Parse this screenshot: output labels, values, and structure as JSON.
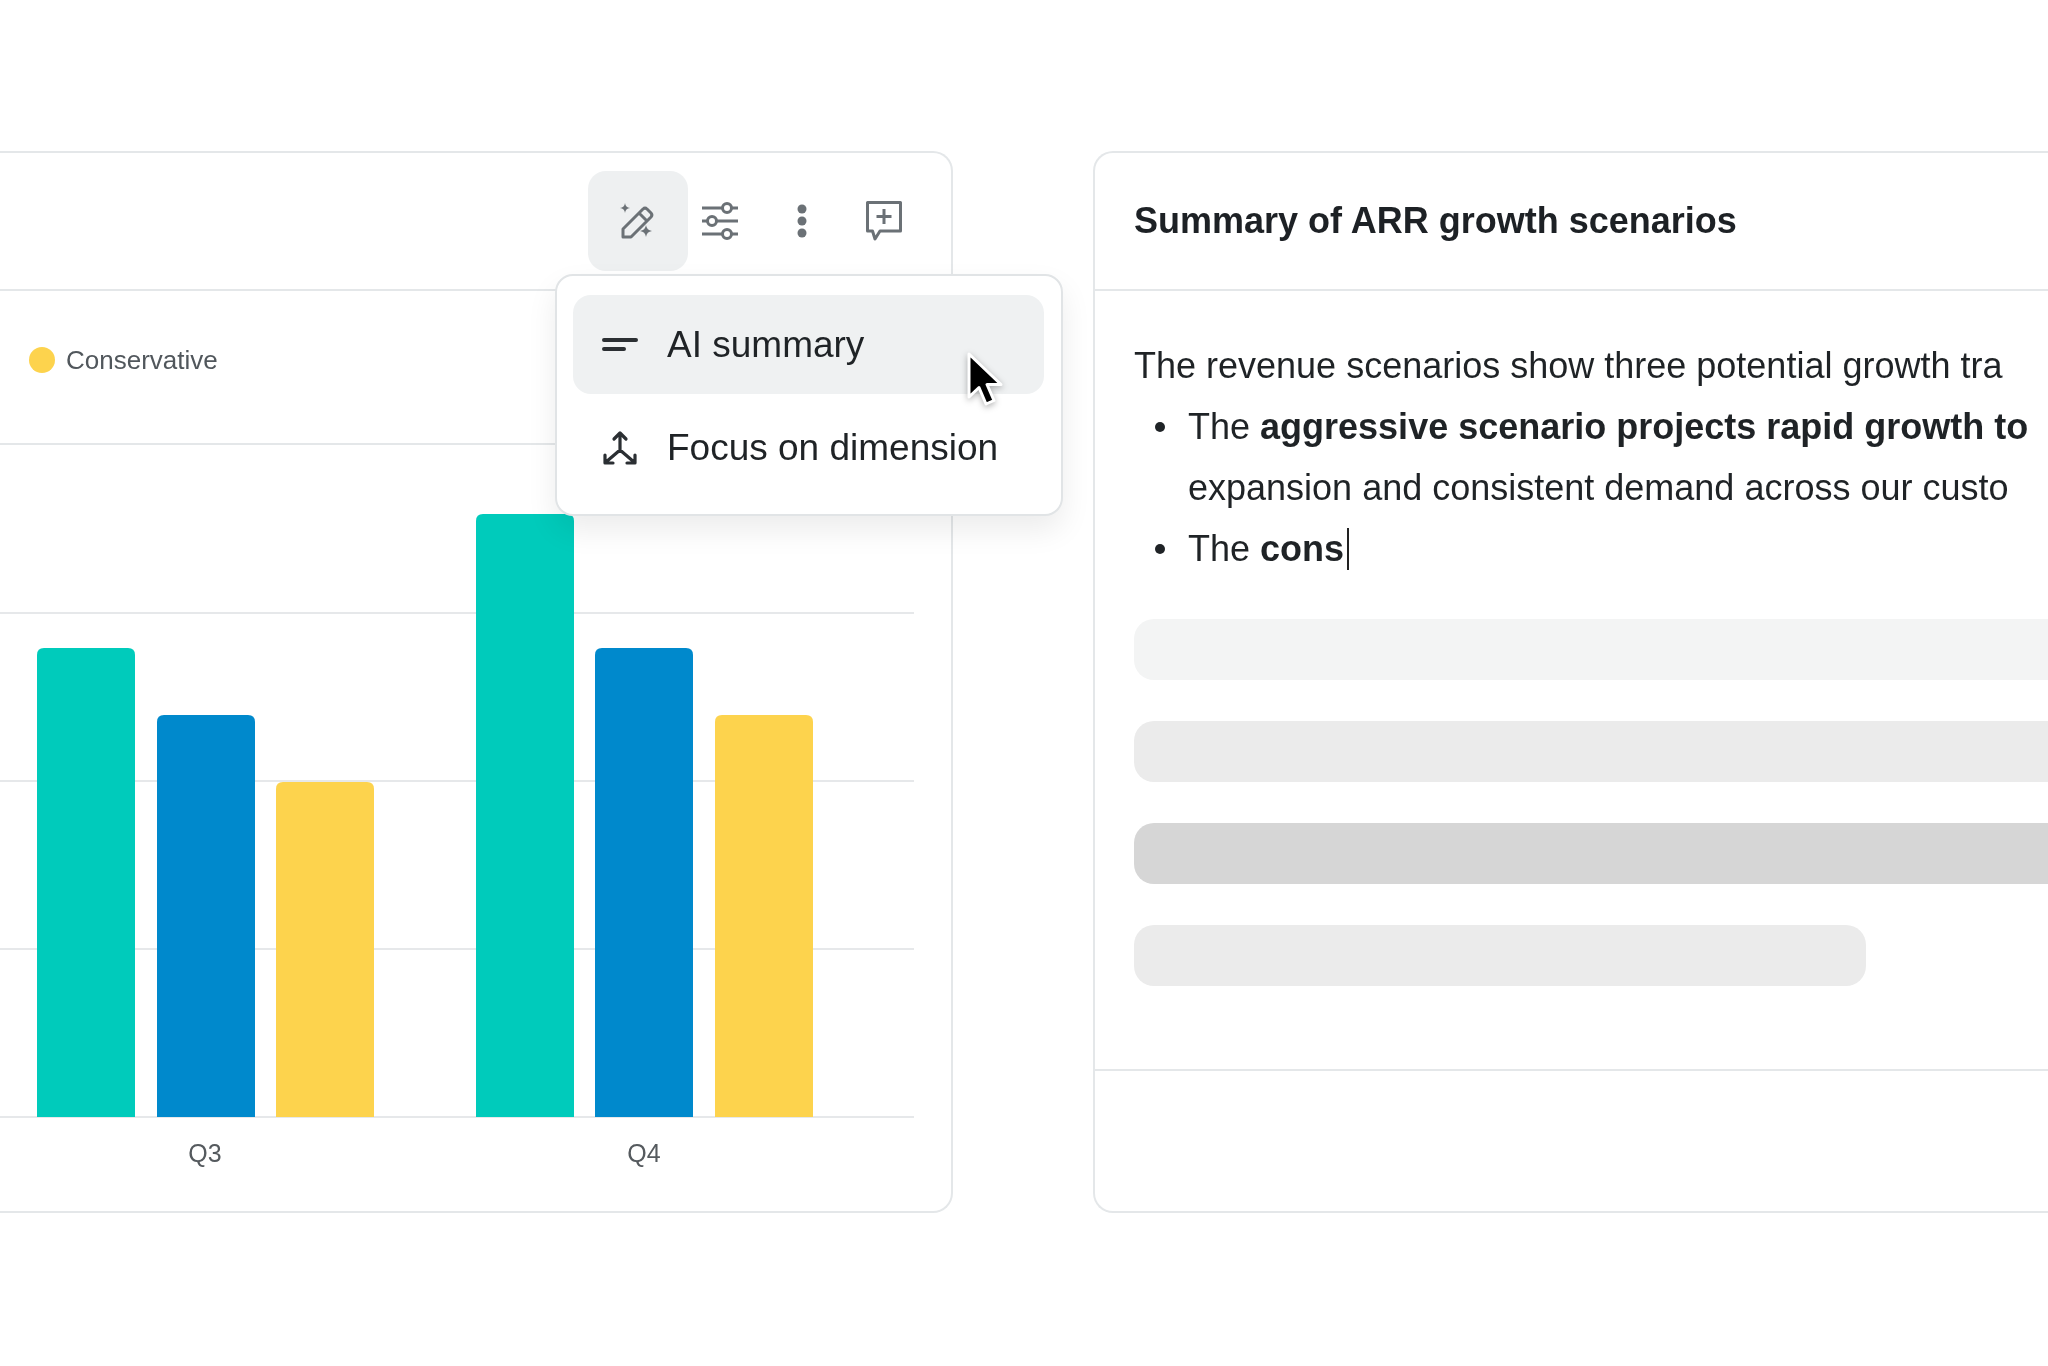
{
  "chart_card": {
    "toolbar": [
      {
        "kind": "ai-edit",
        "active": true
      },
      {
        "kind": "filters",
        "active": false
      },
      {
        "kind": "more",
        "active": false
      },
      {
        "kind": "comment",
        "active": false
      }
    ],
    "menu": {
      "items": [
        {
          "kind": "summary",
          "label": "AI summary",
          "highlighted": true
        },
        {
          "kind": "focus",
          "label": "Focus on dimension",
          "highlighted": false
        }
      ]
    },
    "legend": [
      {
        "label": "Conservative",
        "color": "#fdd34d"
      }
    ],
    "x_labels": [
      "Q3",
      "Q4"
    ]
  },
  "summary_card": {
    "title": "Summary of ARR growth scenarios",
    "intro": "The revenue scenarios show three potential growth tra",
    "bullets": [
      {
        "lines": [
          "The **aggressive scenario projects rapid growth to**",
          "expansion and consistent demand across our custo"
        ],
        "typing": false
      },
      {
        "lines": [
          "The **cons**"
        ],
        "typing": true
      }
    ],
    "skeleton": [
      {
        "kind": "full"
      },
      {
        "kind": "full"
      },
      {
        "kind": "full"
      },
      {
        "kind": "short"
      }
    ]
  }
}
